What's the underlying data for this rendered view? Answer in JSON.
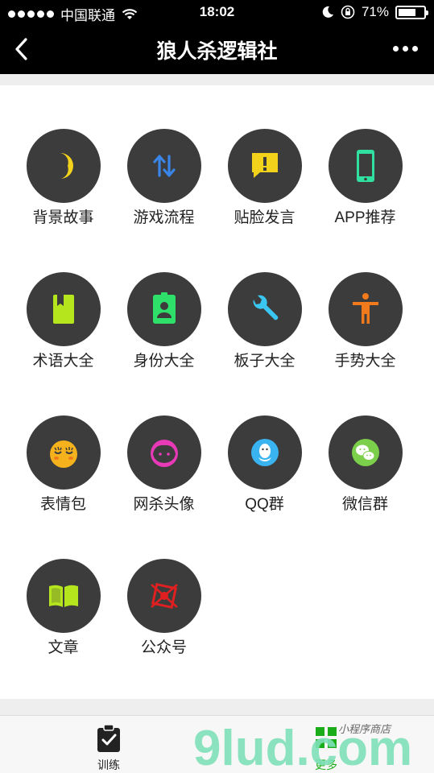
{
  "status_bar": {
    "carrier": "中国联通",
    "time": "18:02",
    "battery": "71%",
    "battery_level": 0.71
  },
  "nav": {
    "title": "狼人杀逻辑社",
    "back_icon": "back-arrow-icon",
    "more_icon": "more-dots-icon"
  },
  "grid": [
    {
      "label": "背景故事",
      "icon": "moon-icon",
      "color": "#f2d21b"
    },
    {
      "label": "游戏流程",
      "icon": "arrows-updown-icon",
      "color": "#3a86e8"
    },
    {
      "label": "贴脸发言",
      "icon": "speech-exclaim-icon",
      "color": "#f2d21b"
    },
    {
      "label": "APP推荐",
      "icon": "phone-icon",
      "color": "#2fe0a0"
    },
    {
      "label": "术语大全",
      "icon": "book-bookmark-icon",
      "color": "#b5e61d"
    },
    {
      "label": "身份大全",
      "icon": "id-badge-icon",
      "color": "#2ee06a"
    },
    {
      "label": "板子大全",
      "icon": "wrench-icon",
      "color": "#3ac6f0"
    },
    {
      "label": "手势大全",
      "icon": "person-gesture-icon",
      "color": "#f07a1c"
    },
    {
      "label": "表情包",
      "icon": "emoji-face-icon",
      "color": "#f5b21d"
    },
    {
      "label": "网杀头像",
      "icon": "avatar-face-icon",
      "color": "#e83ab7"
    },
    {
      "label": "QQ群",
      "icon": "qq-penguin-icon",
      "color": "#3ab4f0"
    },
    {
      "label": "微信群",
      "icon": "wechat-icon",
      "color": "#7ccf4a"
    },
    {
      "label": "文章",
      "icon": "open-book-icon",
      "color": "#b5e61d"
    },
    {
      "label": "公众号",
      "icon": "stamp-icon",
      "color": "#e02020"
    }
  ],
  "tabbar": {
    "tabs": [
      {
        "label": "训练",
        "icon": "clipboard-check-icon"
      },
      {
        "label": "更多",
        "icon": "grid-more-icon"
      }
    ]
  },
  "watermark": {
    "text": "9lud.com",
    "subtext": "小程序商店"
  }
}
